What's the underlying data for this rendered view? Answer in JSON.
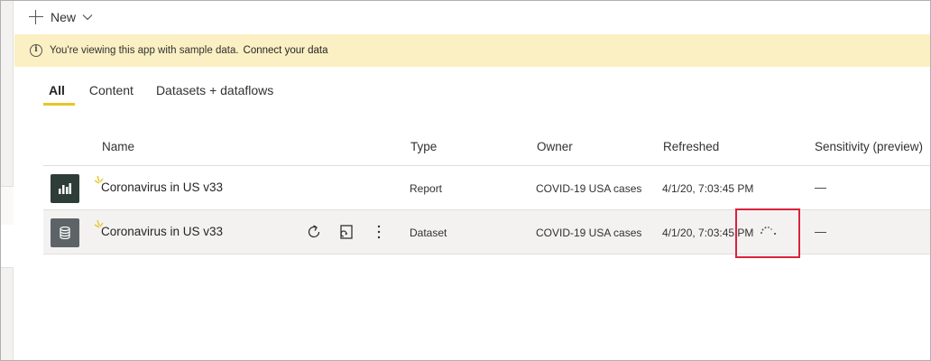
{
  "toolbar": {
    "new_label": "New"
  },
  "banner": {
    "message": "You're viewing this app with sample data.",
    "link": "Connect your data"
  },
  "tabs": [
    {
      "label": "All",
      "active": true
    },
    {
      "label": "Content",
      "active": false
    },
    {
      "label": "Datasets + dataflows",
      "active": false
    }
  ],
  "table": {
    "headers": {
      "name": "Name",
      "type": "Type",
      "owner": "Owner",
      "refreshed": "Refreshed",
      "sensitivity": "Sensitivity (preview)"
    },
    "rows": [
      {
        "icon": "report-icon",
        "name": "Coronavirus in US v33",
        "type": "Report",
        "owner": "COVID-19 USA cases",
        "refreshed": "4/1/20, 7:03:45 PM",
        "sensitivity": "—"
      },
      {
        "icon": "dataset-icon",
        "name": "Coronavirus in US v33",
        "type": "Dataset",
        "owner": "COVID-19 USA cases",
        "refreshed": "4/1/20, 7:03:45 PM",
        "sensitivity": "—",
        "refreshing": true
      }
    ]
  },
  "colors": {
    "banner_bg": "#fbf0c3",
    "tab_underline": "#e8c627",
    "highlight_border": "#d9233a",
    "new_sparkle": "#e8c627"
  }
}
